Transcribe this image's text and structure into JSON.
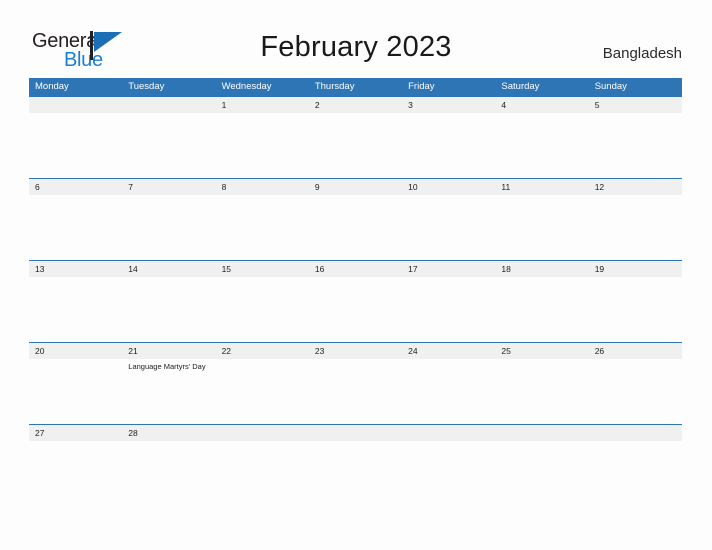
{
  "brand": {
    "name_part1": "General",
    "name_part2": "Blue",
    "logo_icon": "flag-triangle-icon",
    "accent_color": "#1b7fd4"
  },
  "header": {
    "title": "February 2023",
    "country": "Bangladesh"
  },
  "theme": {
    "header_blue": "#2e75b6",
    "strip_gray": "#f0f0f0",
    "page_background": "#fdfdfd",
    "text_color": "#222222"
  },
  "calendar": {
    "month": "February",
    "year": "2023",
    "weekdays": [
      "Monday",
      "Tuesday",
      "Wednesday",
      "Thursday",
      "Friday",
      "Saturday",
      "Sunday"
    ],
    "weeks": [
      {
        "days": [
          {
            "num": "",
            "event": ""
          },
          {
            "num": "",
            "event": ""
          },
          {
            "num": "1",
            "event": ""
          },
          {
            "num": "2",
            "event": ""
          },
          {
            "num": "3",
            "event": ""
          },
          {
            "num": "4",
            "event": ""
          },
          {
            "num": "5",
            "event": ""
          }
        ]
      },
      {
        "days": [
          {
            "num": "6",
            "event": ""
          },
          {
            "num": "7",
            "event": ""
          },
          {
            "num": "8",
            "event": ""
          },
          {
            "num": "9",
            "event": ""
          },
          {
            "num": "10",
            "event": ""
          },
          {
            "num": "11",
            "event": ""
          },
          {
            "num": "12",
            "event": ""
          }
        ]
      },
      {
        "days": [
          {
            "num": "13",
            "event": ""
          },
          {
            "num": "14",
            "event": ""
          },
          {
            "num": "15",
            "event": ""
          },
          {
            "num": "16",
            "event": ""
          },
          {
            "num": "17",
            "event": ""
          },
          {
            "num": "18",
            "event": ""
          },
          {
            "num": "19",
            "event": ""
          }
        ]
      },
      {
        "days": [
          {
            "num": "20",
            "event": ""
          },
          {
            "num": "21",
            "event": "Language Martyrs' Day"
          },
          {
            "num": "22",
            "event": ""
          },
          {
            "num": "23",
            "event": ""
          },
          {
            "num": "24",
            "event": ""
          },
          {
            "num": "25",
            "event": ""
          },
          {
            "num": "26",
            "event": ""
          }
        ]
      },
      {
        "days": [
          {
            "num": "27",
            "event": ""
          },
          {
            "num": "28",
            "event": ""
          },
          {
            "num": "",
            "event": ""
          },
          {
            "num": "",
            "event": ""
          },
          {
            "num": "",
            "event": ""
          },
          {
            "num": "",
            "event": ""
          },
          {
            "num": "",
            "event": ""
          }
        ]
      }
    ]
  }
}
